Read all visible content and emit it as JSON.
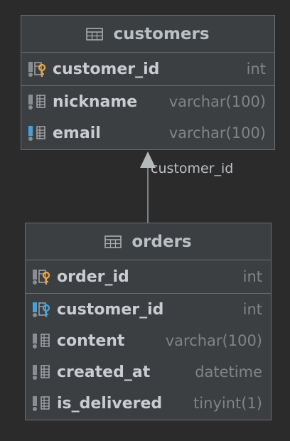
{
  "tables": {
    "customers": {
      "title": "customers",
      "pk": [
        {
          "name": "customer_id",
          "type": "int",
          "icon": "primary-key-column-icon"
        }
      ],
      "columns": [
        {
          "name": "nickname",
          "type": "varchar(100)",
          "icon": "column-icon"
        },
        {
          "name": "email",
          "type": "varchar(100)",
          "icon": "indexed-column-icon"
        }
      ]
    },
    "orders": {
      "title": "orders",
      "pk": [
        {
          "name": "order_id",
          "type": "int",
          "icon": "primary-key-column-icon"
        }
      ],
      "columns": [
        {
          "name": "customer_id",
          "type": "int",
          "icon": "foreign-key-column-icon"
        },
        {
          "name": "content",
          "type": "varchar(100)",
          "icon": "column-icon"
        },
        {
          "name": "created_at",
          "type": "datetime",
          "icon": "column-icon"
        },
        {
          "name": "is_delivered",
          "type": "tinyint(1)",
          "icon": "column-icon"
        }
      ]
    }
  },
  "relation": {
    "label": "customer_id",
    "from": "orders",
    "to": "customers"
  },
  "colors": {
    "background": "#2b2b2b",
    "table_bg": "#3c3f41",
    "border": "#6b6e70",
    "pk_key": "#e8a33d",
    "fk_key": "#4a9fd9",
    "index_bar": "#4a9fd9"
  }
}
